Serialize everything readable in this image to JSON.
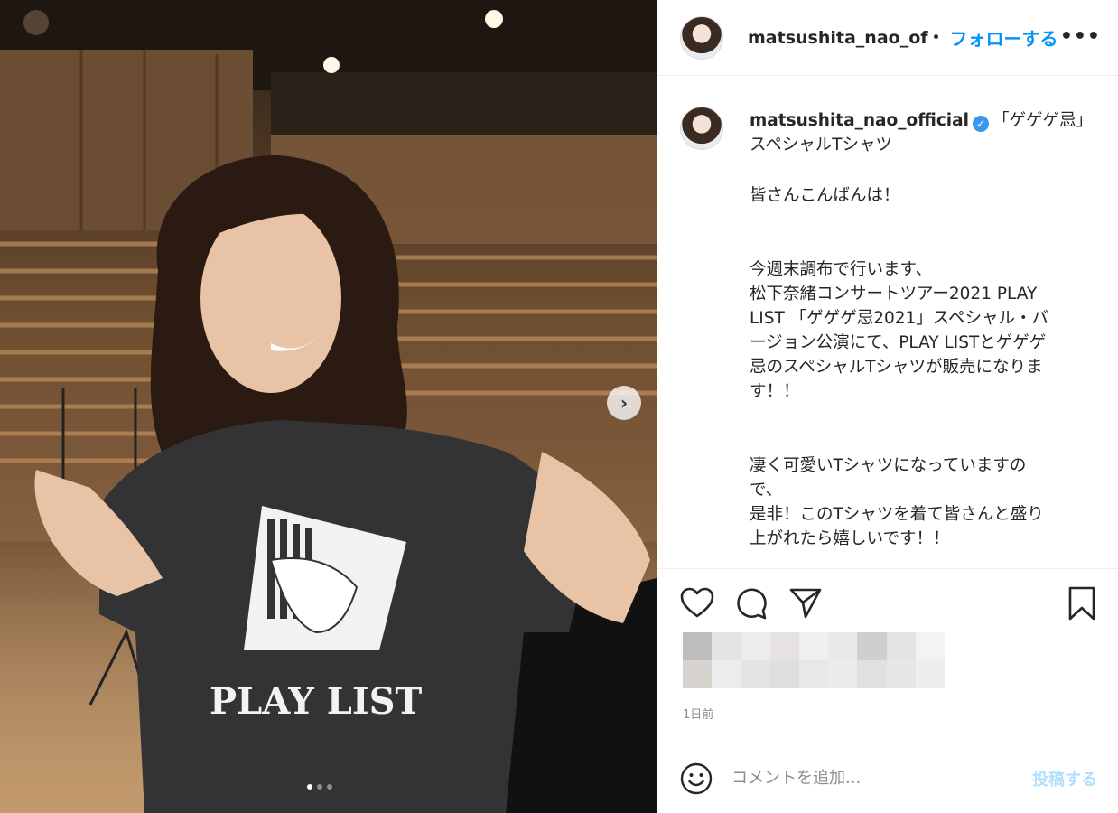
{
  "post": {
    "username_truncated": "matsushita_nao_of",
    "separator": "•",
    "follow_label": "フォローする",
    "more_label": "•••",
    "photo_alt_icon": "photo",
    "carousel_next_glyph": "›",
    "carousel_total": 3,
    "carousel_index": 1
  },
  "caption": {
    "username": "matsushita_nao_official",
    "verified_glyph": "✓",
    "lines": [
      "「ゲゲゲ忌」",
      "スペシャルTシャツ",
      "皆さんこんばんは！",
      "今週末調布で行います、",
      "松下奈緒コンサートツアー2021 PLAY",
      "LIST 「ゲゲゲ忌2021」スペシャル・バ",
      "ージョン公演にて、PLAY LISTとゲゲゲ",
      "忌のスペシャルTシャツが販売になりま",
      "す！！",
      "凄く可愛いTシャツになっていますの",
      "で、",
      "是非！このTシャツを着て皆さんと盛り",
      "上がれたら嬉しいです！！"
    ]
  },
  "actions": {
    "like_icon": "heart-icon",
    "comment_icon": "comment-icon",
    "share_icon": "share-icon",
    "save_icon": "bookmark-icon",
    "timestamp": "1日前"
  },
  "comment_box": {
    "placeholder": "コメントを追加...",
    "post_label": "投稿する",
    "emoji_icon": "emoji-icon"
  },
  "colors": {
    "accent": "#0095f6",
    "post_disabled": "#b2dffc",
    "border": "#efefef",
    "text": "#262626",
    "muted": "#8e8e8e"
  }
}
